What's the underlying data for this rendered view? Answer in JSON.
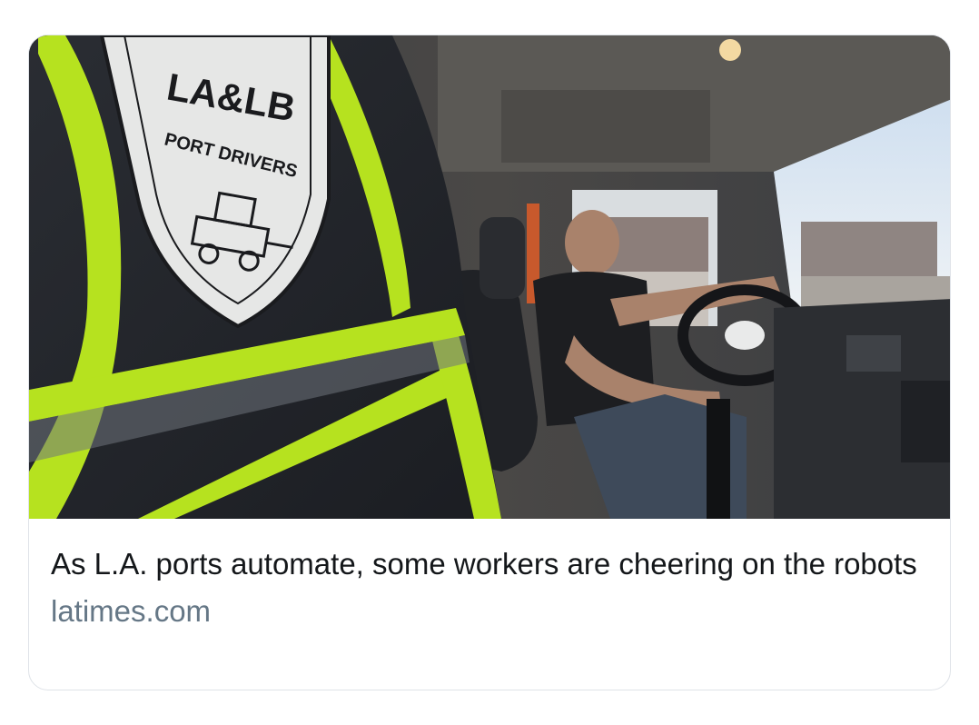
{
  "link_card": {
    "headline": "As L.A. ports automate, some workers are cheering on the robots",
    "domain": "latimes.com",
    "image": {
      "subject": "trucker-in-cab-photo",
      "vest_patch_line1": "LA&LB",
      "vest_patch_line2": "PORT DRIVERS"
    }
  },
  "colors": {
    "headline": "#14171a",
    "domain": "#657786",
    "card_border": "#dfe3e8",
    "reflective_stripe": "#b6e21f"
  }
}
